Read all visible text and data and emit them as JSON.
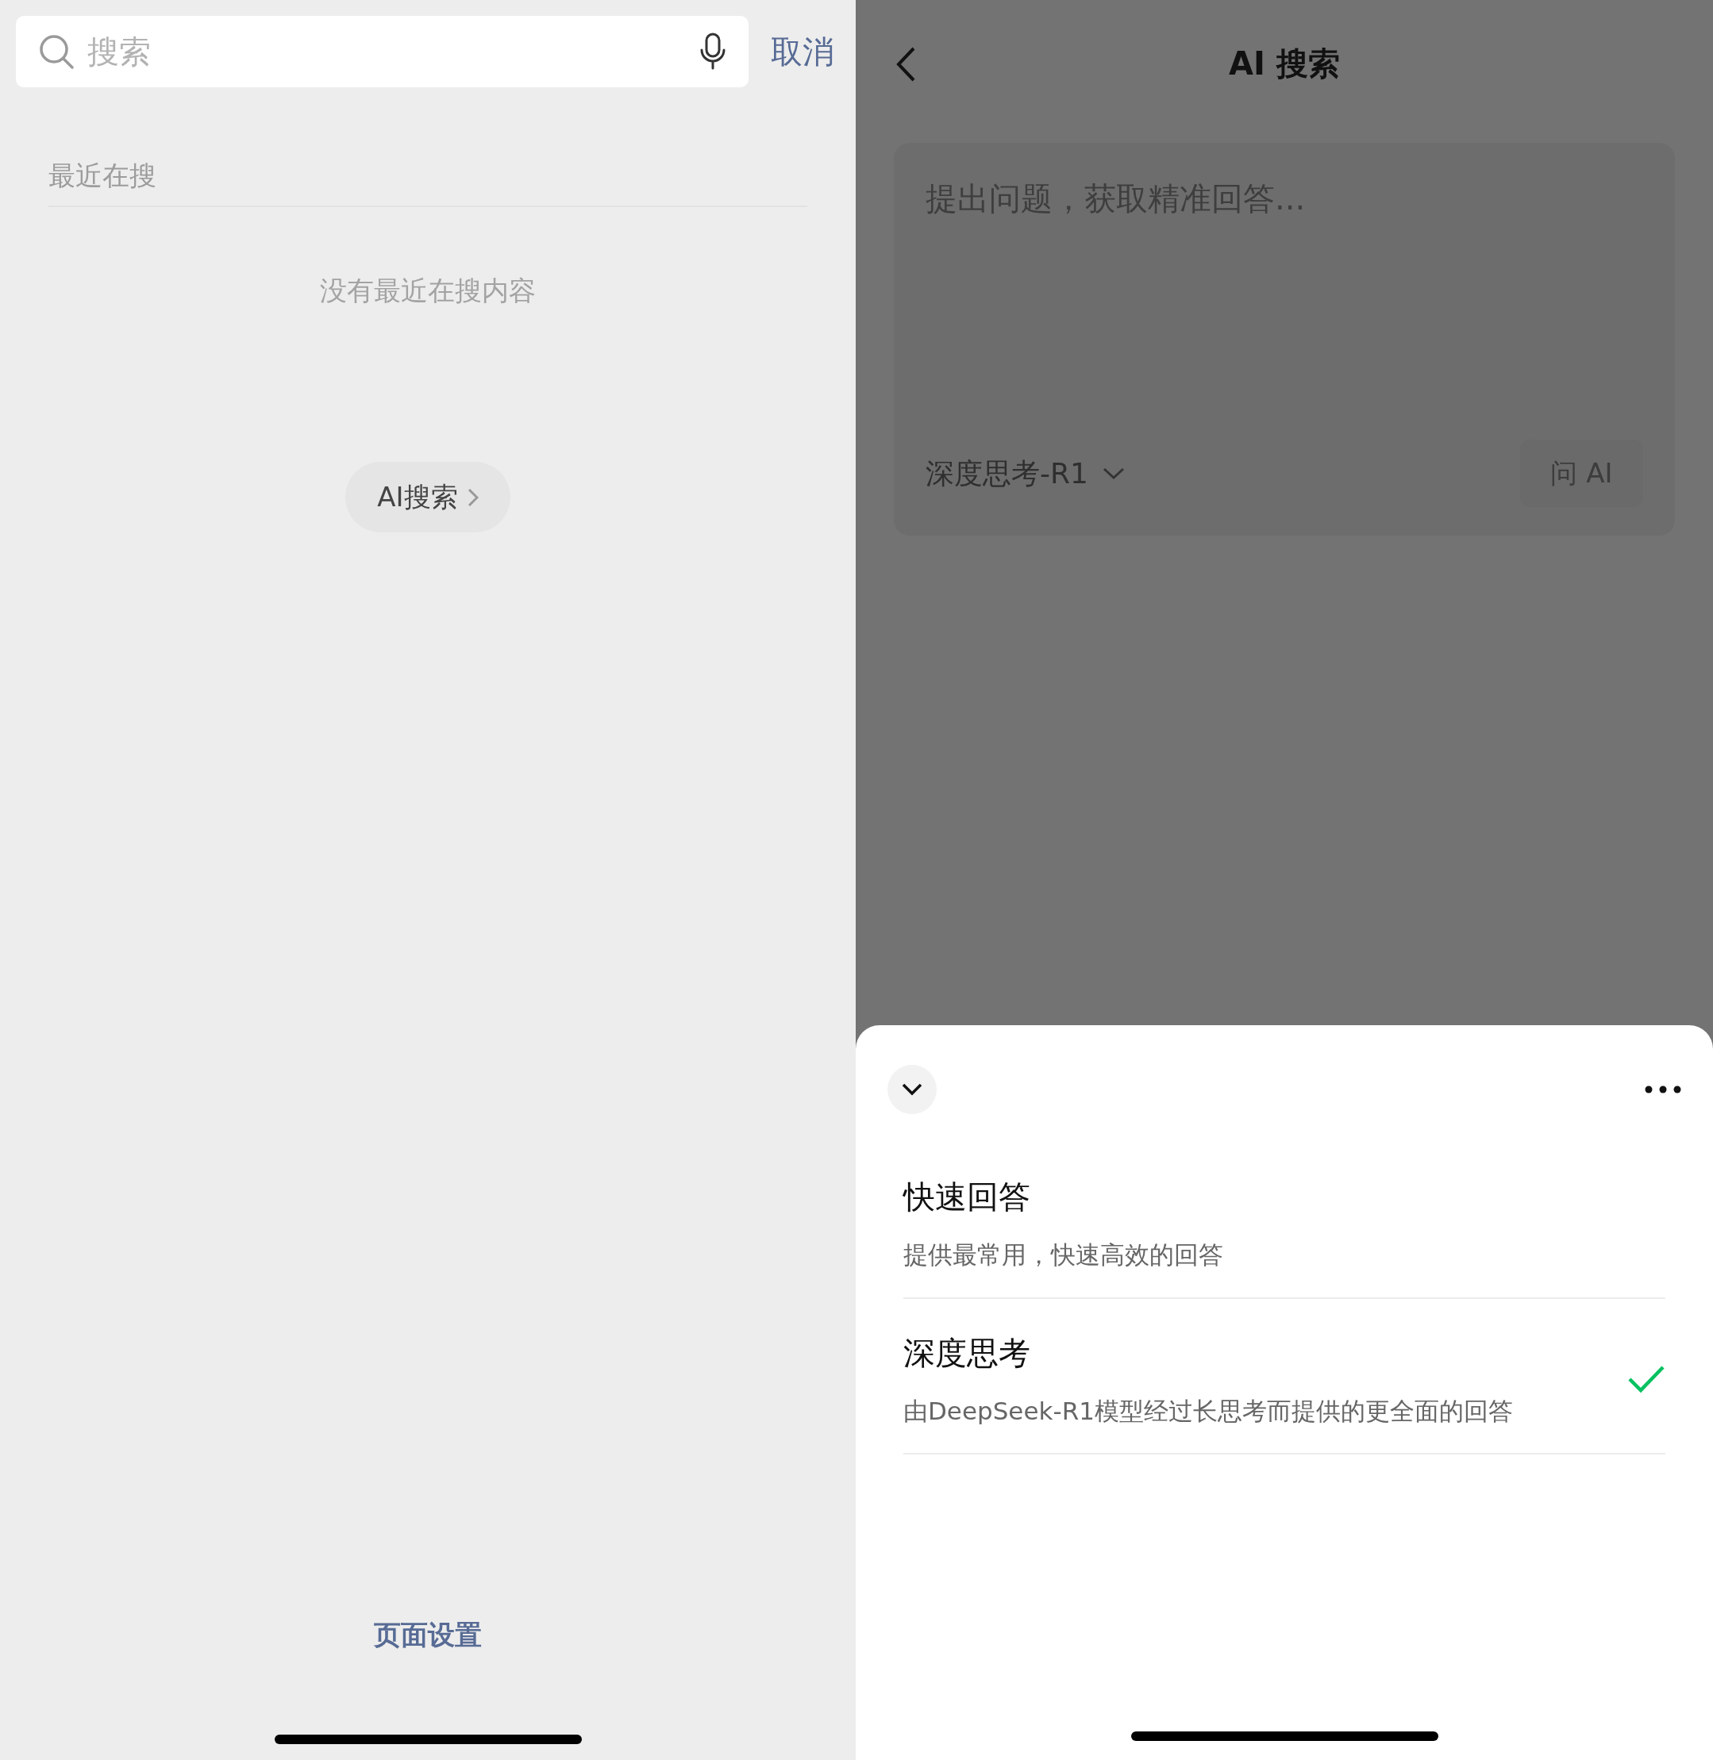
{
  "left": {
    "search": {
      "placeholder": "搜索"
    },
    "cancel": "取消",
    "recent_title": "最近在搜",
    "empty_text": "没有最近在搜内容",
    "ai_search_button": "AI搜索",
    "page_settings": "页面设置"
  },
  "right": {
    "title": "AI 搜索",
    "question": {
      "placeholder": "提出问题，获取精准回答..."
    },
    "model_selector": "深度思考-R1",
    "ask_button": "问 AI",
    "sheet": {
      "options": [
        {
          "title": "快速回答",
          "description": "提供最常用，快速高效的回答",
          "selected": false
        },
        {
          "title": "深度思考",
          "description": "由DeepSeek-R1模型经过长思考而提供的更全面的回答",
          "selected": true
        }
      ]
    }
  }
}
